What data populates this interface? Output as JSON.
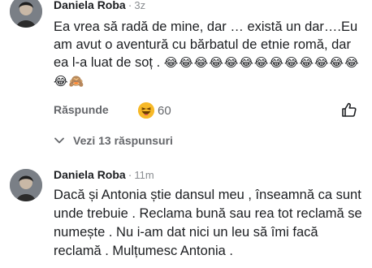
{
  "comments": [
    {
      "author": "Daniela Roba",
      "separator": "·",
      "time": "3z",
      "text": "Ea vrea să radă de mine, dar … există un dar….Eu am avut o aventură cu bărbatul de etnie romă, dar ea l-a luat de soț . ",
      "emojis": "😂😂😂😂😂😂😂😂😂😂😂😂😂😂🙈",
      "reply_label": "Răspunde",
      "reaction_icon": "laughing-emoji",
      "reaction_count": "60",
      "view_replies_label": "Vezi 13 răspunsuri"
    },
    {
      "author": "Daniela Roba",
      "separator": "·",
      "time": "11m",
      "text": "Dacă și Antonia știe dansul meu , înseamnă ca sunt unde trebuie . Reclama  bună sau rea tot reclamă se numește . Nu i-am dat nici un leu să îmi facă reclamă . Mulțumesc Antonia ."
    }
  ],
  "colors": {
    "text": "#1c1e21",
    "muted": "#65676b",
    "timestamp": "#8a8d91",
    "reaction": "#f7b928"
  }
}
